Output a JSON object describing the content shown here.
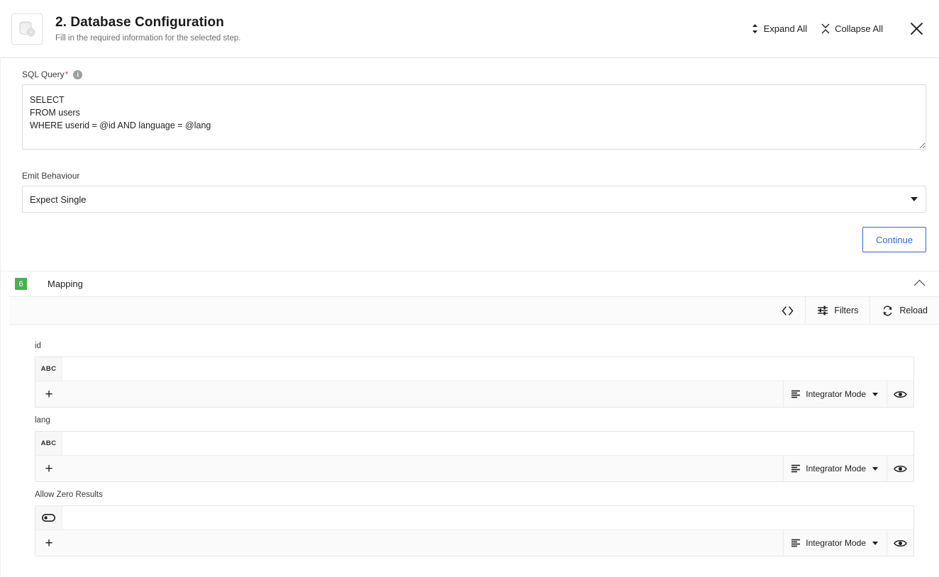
{
  "header": {
    "icon": "database-gear-icon",
    "title": "2. Database Configuration",
    "subtitle": "Fill in the required information for the selected step.",
    "expand_all_label": "Expand All",
    "collapse_all_label": "Collapse All",
    "close_label": "×"
  },
  "form": {
    "sql_query": {
      "label": "SQL Query",
      "required_marker": "*",
      "info_glyph": "i",
      "value": "SELECT\nFROM users\nWHERE userid = @id AND language = @lang",
      "placeholder": ""
    },
    "emit_behaviour": {
      "label": "Emit Behaviour",
      "value": "Expect Single",
      "options": [
        "Expect Single"
      ]
    },
    "continue_label": "Continue"
  },
  "mapping": {
    "step_number": "6",
    "title": "Mapping",
    "accent_color": "#4caf50",
    "toolbar": [
      {
        "name": "code-view",
        "label": "",
        "icon": "code-brackets-icon"
      },
      {
        "name": "filters",
        "label": "Filters",
        "icon": "filters-icon"
      },
      {
        "name": "reload",
        "label": "Reload",
        "icon": "reload-icon"
      }
    ],
    "mode_label": "Integrator Mode",
    "add_glyph": "+",
    "fields": [
      {
        "label": "id",
        "type_label": "ABC",
        "type_icon": "abc-icon",
        "value": "",
        "mode": "Integrator Mode"
      },
      {
        "label": "lang",
        "type_label": "ABC",
        "type_icon": "abc-icon",
        "value": "",
        "mode": "Integrator Mode"
      },
      {
        "label": "Allow Zero Results",
        "type_label": "",
        "type_icon": "boolean-toggle-icon",
        "value": "",
        "mode": "Integrator Mode"
      }
    ]
  },
  "colors": {
    "accent_blue": "#3268d5",
    "badge_green": "#4caf50",
    "required_red": "#e5405e"
  }
}
